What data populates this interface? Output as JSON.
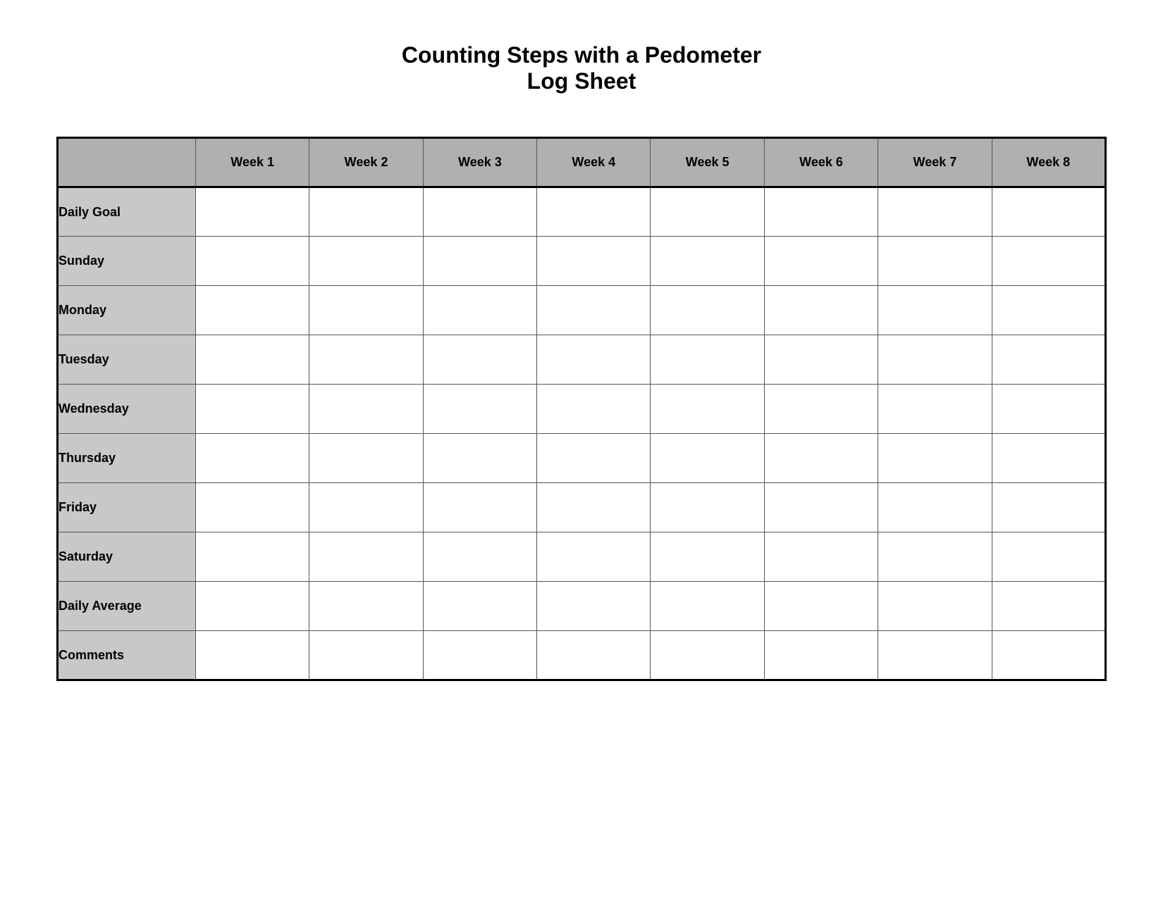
{
  "page": {
    "title_line1": "Counting Steps with a Pedometer",
    "title_line2": "Log Sheet"
  },
  "table": {
    "header": {
      "empty": "",
      "weeks": [
        "Week 1",
        "Week 2",
        "Week 3",
        "Week 4",
        "Week 5",
        "Week 6",
        "Week 7",
        "Week 8"
      ]
    },
    "rows": [
      {
        "label": "Daily Goal"
      },
      {
        "label": "Sunday"
      },
      {
        "label": "Monday"
      },
      {
        "label": "Tuesday"
      },
      {
        "label": "Wednesday"
      },
      {
        "label": "Thursday"
      },
      {
        "label": "Friday"
      },
      {
        "label": "Saturday"
      },
      {
        "label": "Daily Average"
      },
      {
        "label": "Comments"
      }
    ]
  }
}
